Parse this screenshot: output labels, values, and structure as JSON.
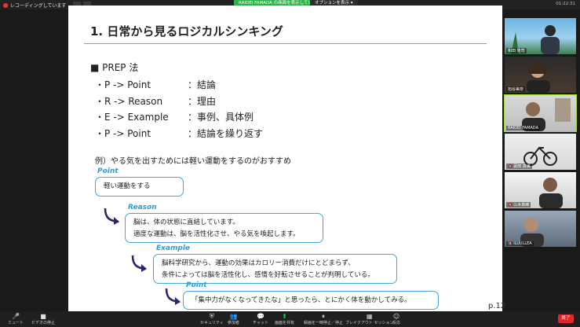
{
  "topbar": {
    "recording_label": "レコーディングしています",
    "share_label": "RAIDEI FAMADA の画面を表示しています",
    "view_options": "オプションを表示 ▾",
    "clock": "01:22:31"
  },
  "slide": {
    "title": "1. 日常から見るロジカルシンキング",
    "prep_heading": "■ PREP 法",
    "prep_items": [
      {
        "term": "・P -> Point",
        "def": "：結論"
      },
      {
        "term": "・R -> Reason",
        "def": "：理由"
      },
      {
        "term": "・E -> Example",
        "def": "：事例、具体例"
      },
      {
        "term": "・P -> Point",
        "def": "：結論を繰り返す"
      }
    ],
    "example_title": "例）やる気を出すためには軽い運動をするのがおすすめ",
    "flow": [
      {
        "label": "Point",
        "lines": [
          "軽い運動をする"
        ]
      },
      {
        "label": "Reason",
        "lines": [
          "脳は、体の状態に直結しています。",
          "適度な運動は、脳を活性化させ、やる気を喚起します。"
        ]
      },
      {
        "label": "Example",
        "lines": [
          "脳科学研究から、運動の効果はカロリー消費だけにとどまらず、",
          "条件によっては脳を活性化し、感情を好転させることが判明している。"
        ]
      },
      {
        "label": "Point",
        "lines": [
          "「集中力がなくなってきたな」と思ったら、とにかく体を動かしてみる。"
        ]
      }
    ],
    "page": "p.12"
  },
  "participants": [
    {
      "name": "和田 隆司",
      "muted": false,
      "active": false
    },
    {
      "name": "旭谷美奈",
      "muted": false,
      "active": false
    },
    {
      "name": "RAIDEI FAMADA",
      "muted": false,
      "active": true
    },
    {
      "name": "武田 真美",
      "muted": true,
      "active": false
    },
    {
      "name": "三木真峰",
      "muted": true,
      "active": false
    },
    {
      "name": "ILUULLEA",
      "muted": true,
      "active": false
    }
  ],
  "toolbar": {
    "mute": "ミュート",
    "video_stop": "ビデオの停止",
    "security": "セキュリティ",
    "participants": "参加者",
    "participants_count": "21",
    "chat": "チャット",
    "share_screen": "画面を共有",
    "record": "録画を一時停止／停止",
    "breakout": "ブレイクアウト セッション",
    "reactions": "反応",
    "end": "終了"
  },
  "colors": {
    "accent_blue": "#2a9fd8",
    "arrow_navy": "#2b2570",
    "share_green": "#2db34a",
    "end_red": "#e02828"
  }
}
